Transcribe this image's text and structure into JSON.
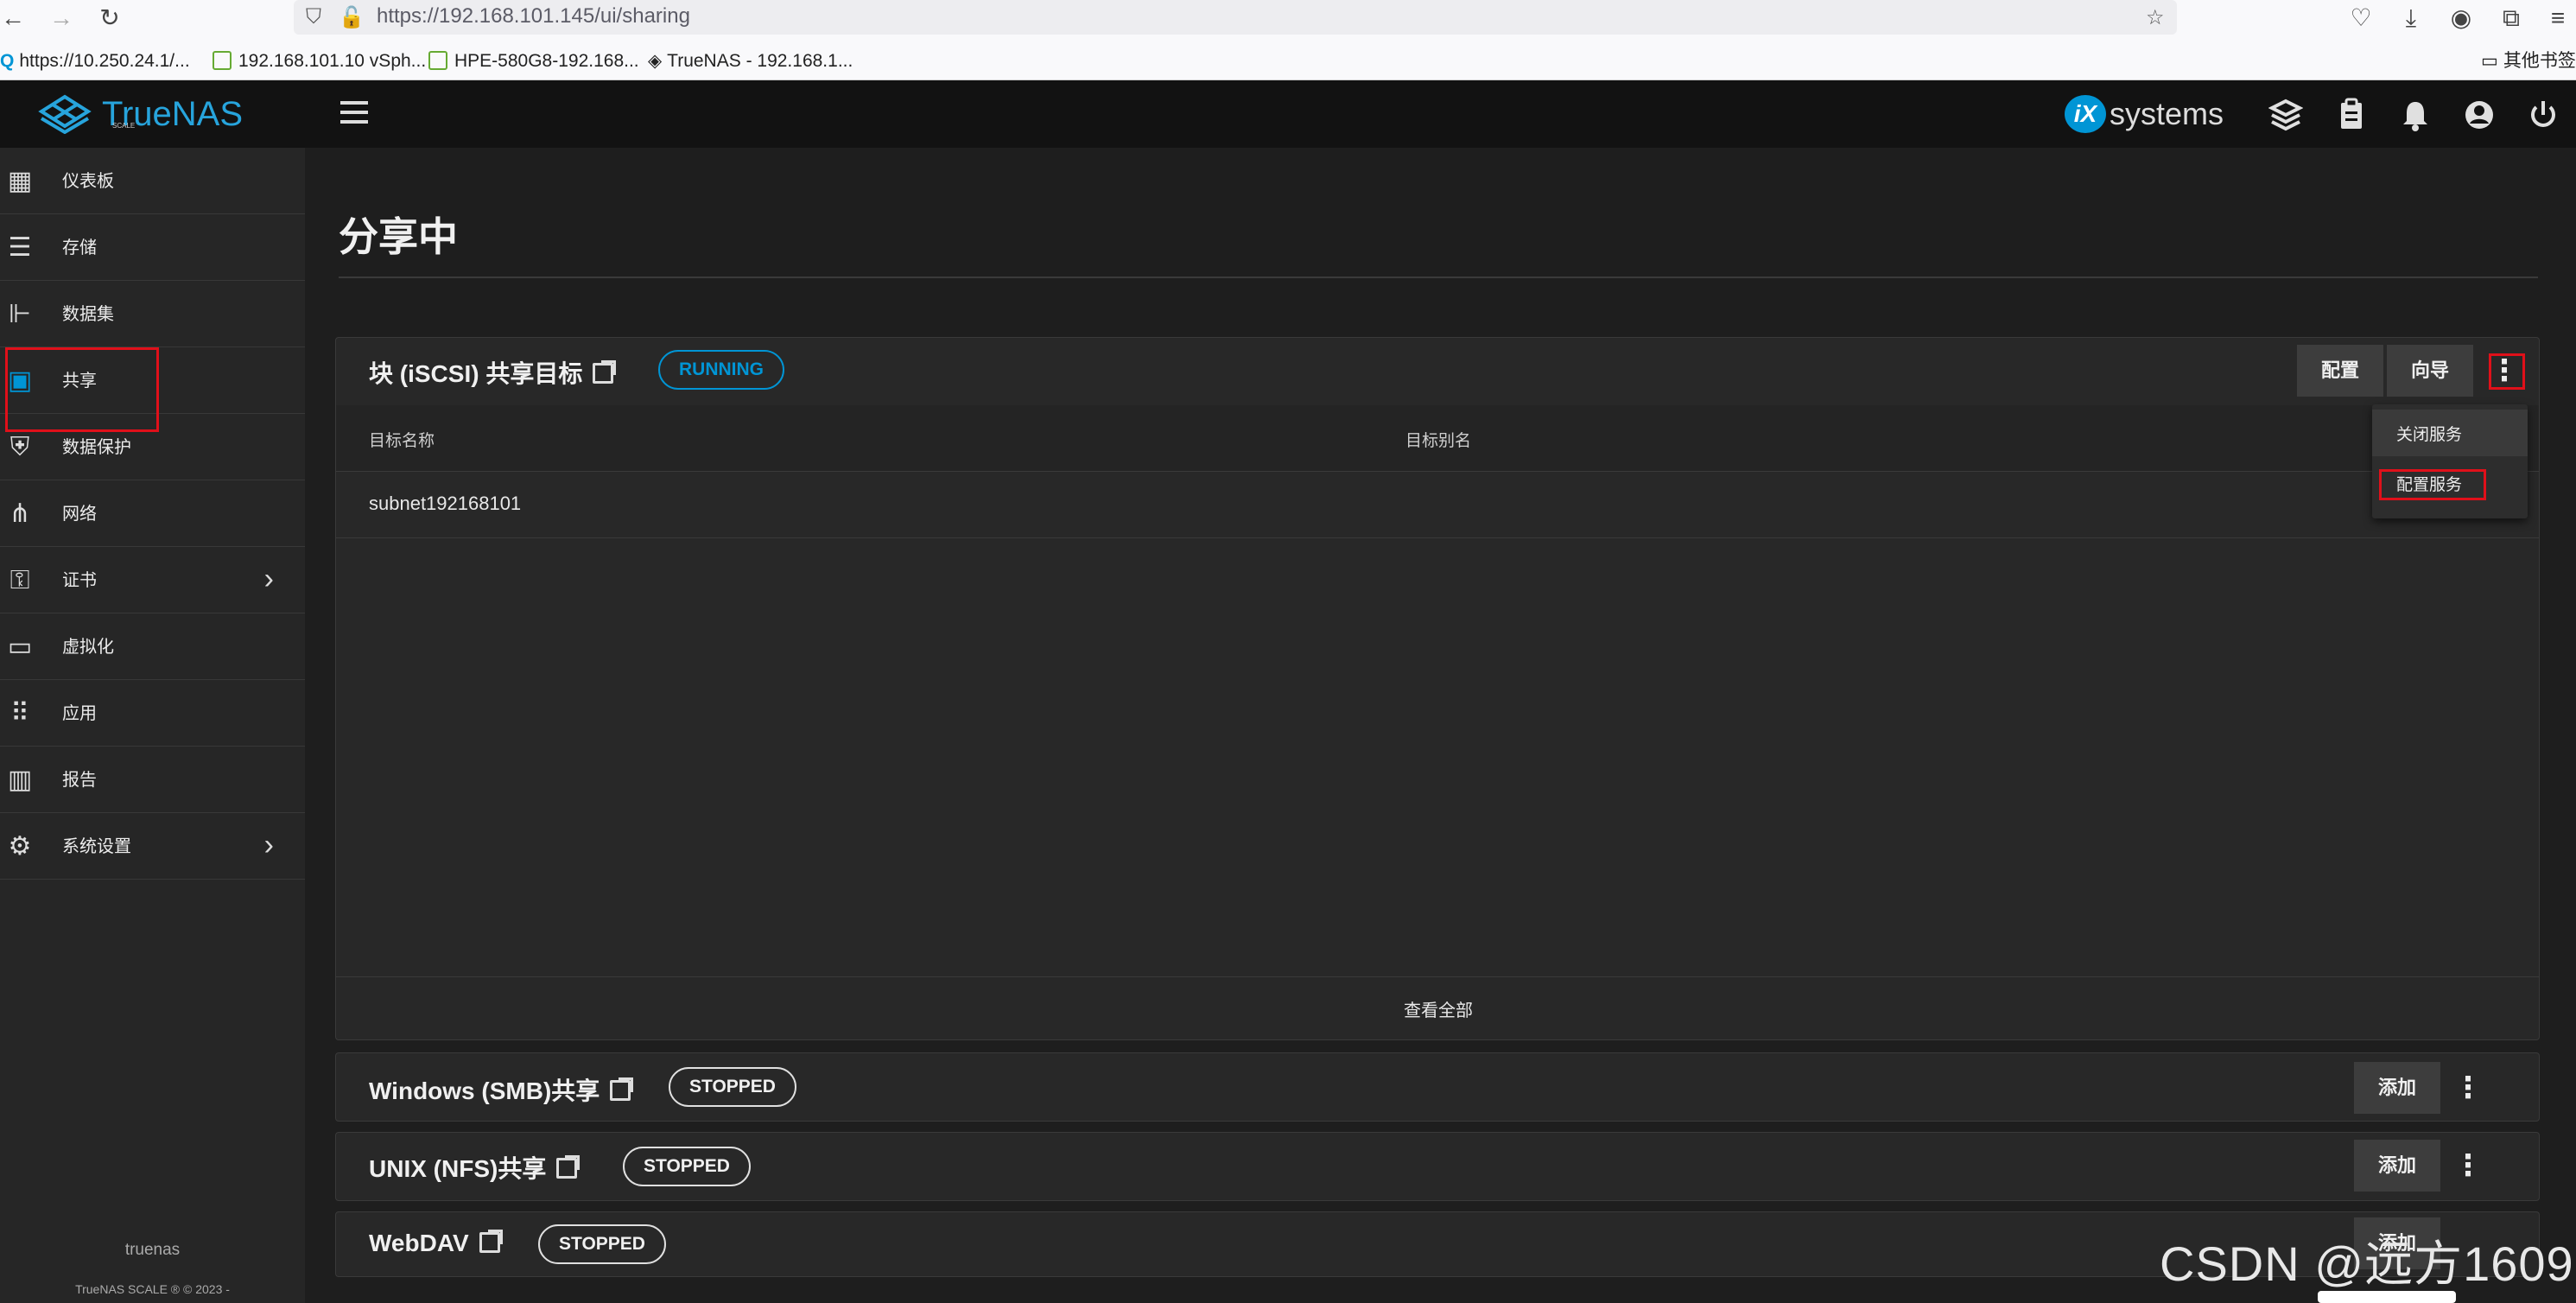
{
  "browser": {
    "url": "https://192.168.101.145/ui/sharing",
    "bookmarks": [
      "https://10.250.24.1/...",
      "192.168.101.10 vSph...",
      "HPE-580G8-192.168...",
      "TrueNAS - 192.168.1...",
      "其他书签"
    ]
  },
  "header": {
    "logo_text": "TrueNAS",
    "logo_sub": "SCALE",
    "vendor_badge": "iX",
    "vendor_text": "systems"
  },
  "sidebar": {
    "items": [
      {
        "label": "仪表板",
        "icon": "dashboard-icon"
      },
      {
        "label": "存储",
        "icon": "storage-icon"
      },
      {
        "label": "数据集",
        "icon": "datasets-icon"
      },
      {
        "label": "共享",
        "icon": "shares-icon"
      },
      {
        "label": "数据保护",
        "icon": "shield-icon"
      },
      {
        "label": "网络",
        "icon": "network-icon"
      },
      {
        "label": "证书",
        "icon": "key-icon"
      },
      {
        "label": "虚拟化",
        "icon": "laptop-icon"
      },
      {
        "label": "应用",
        "icon": "apps-grid-icon"
      },
      {
        "label": "报告",
        "icon": "chart-icon"
      },
      {
        "label": "系统设置",
        "icon": "gear-icon"
      }
    ],
    "hostname": "truenas",
    "copyright": "TrueNAS SCALE ® © 2023 -"
  },
  "page": {
    "title": "分享中"
  },
  "iscsi": {
    "title": "块 (iSCSI) 共享目标",
    "status": "RUNNING",
    "config_button": "配置",
    "wizard_button": "向导",
    "col_name": "目标名称",
    "col_alias": "目标别名",
    "rows": [
      {
        "name": "subnet192168101",
        "alias": ""
      }
    ],
    "view_all": "查看全部",
    "menu": [
      "关闭服务",
      "配置服务"
    ]
  },
  "smb": {
    "title": "Windows (SMB)共享",
    "status": "STOPPED",
    "add_button": "添加"
  },
  "nfs": {
    "title": "UNIX (NFS)共享",
    "status": "STOPPED",
    "add_button": "添加"
  },
  "webdav": {
    "title": "WebDAV",
    "status": "STOPPED",
    "add_button": "添加"
  },
  "watermark": "CSDN @远方1609",
  "colors": {
    "accent": "#0095d5",
    "highlight_box": "#e0101a",
    "bg": "#1e1e1e",
    "card": "#282828"
  }
}
